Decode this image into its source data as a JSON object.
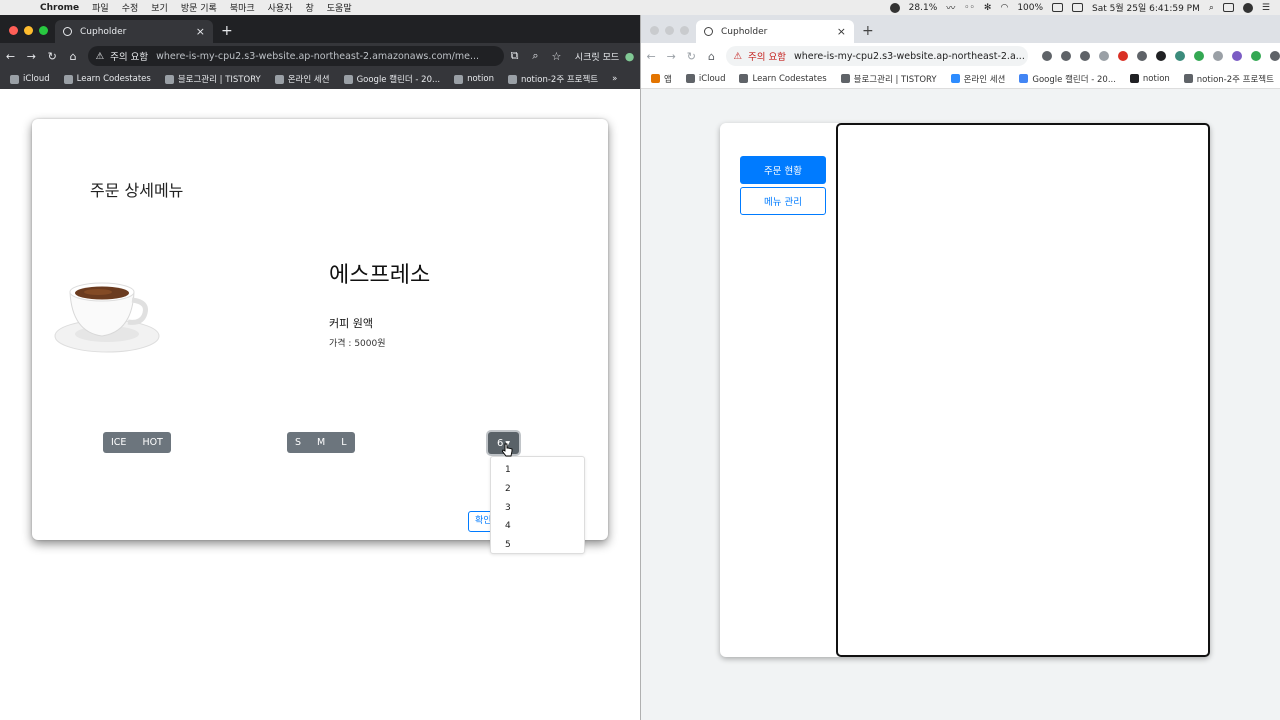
{
  "menubar": {
    "app": "Chrome",
    "items": [
      "파일",
      "수정",
      "보기",
      "방문 기록",
      "북마크",
      "사용자",
      "창",
      "도움말"
    ],
    "battery_percent": "28.1%",
    "wifi_battery": "100%",
    "clock": "Sat 5월 25일 6:41:59 PM"
  },
  "left_window": {
    "tab_title": "Cupholder",
    "security_label": "주의 요함",
    "url": "where-is-my-cpu2.s3-website.ap-northeast-2.amazonaws.com/me...",
    "profile_label": "시크릿 모드",
    "bookmarks": [
      "iCloud",
      "Learn Codestates",
      "블로그관리 | TISTORY",
      "온라인 세션",
      "Google 캘린더 - 20...",
      "notion",
      "notion-2주 프로젝트"
    ],
    "page": {
      "title": "주문 상세메뉴",
      "product_name": "에스프레소",
      "product_desc": "커피 원액",
      "product_price": "가격 : 5000원",
      "temp_options": [
        "ICE",
        "HOT"
      ],
      "size_options": [
        "S",
        "M",
        "L"
      ],
      "quantity_selected": "6",
      "quantity_options": [
        "1",
        "2",
        "3",
        "4",
        "5"
      ],
      "confirm_label": "확인"
    }
  },
  "right_window": {
    "tab_title": "Cupholder",
    "security_label": "주의 요함",
    "url": "where-is-my-cpu2.s3-website.ap-northeast-2.a...",
    "bookmarks": [
      "앱",
      "iCloud",
      "Learn Codestates",
      "블로그관리 | TISTORY",
      "온라인 세션",
      "Google 캘린더 - 20...",
      "notion",
      "notion-2주 프로젝트"
    ],
    "page": {
      "order_status_label": "주문 현황",
      "menu_manage_label": "메뉴 관리"
    }
  },
  "colors": {
    "primary": "#007bff",
    "secondary": "#6c757d",
    "chrome_dark": "#202124"
  }
}
